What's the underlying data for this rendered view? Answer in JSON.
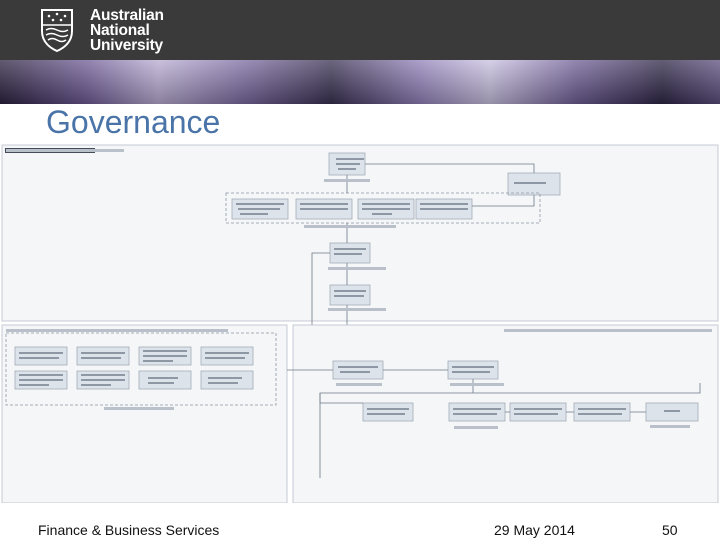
{
  "header": {
    "logo_lines": [
      "Australian",
      "National",
      "University"
    ]
  },
  "slide": {
    "title": "Governance"
  },
  "footer": {
    "left": "Finance & Business Services",
    "date": "29 May 2014",
    "page": "50"
  },
  "colors": {
    "header_bg": "#3a3a3a",
    "title": "#4a74a8",
    "box_fill": "#dde3ea"
  }
}
